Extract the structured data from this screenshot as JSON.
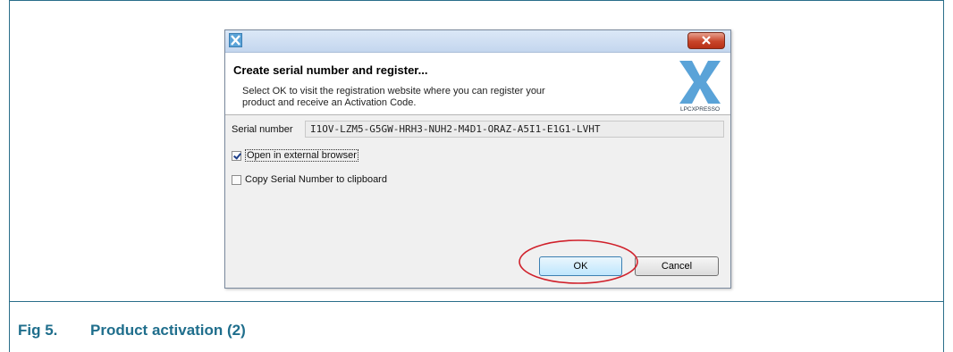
{
  "dialog": {
    "header_title": "Create serial number and register...",
    "header_description": "Select OK to visit the registration website where you can register your product and receive an Activation Code.",
    "logo_text": "LPCXPRESSO",
    "serial_label": "Serial number",
    "serial_value": "I1OV-LZM5-G5GW-HRH3-NUH2-M4D1-ORAZ-A5I1-E1G1-LVHT",
    "options": [
      {
        "label": "Open in external browser",
        "checked": true
      },
      {
        "label": "Copy Serial Number to clipboard",
        "checked": false
      }
    ],
    "ok_label": "OK",
    "cancel_label": "Cancel"
  },
  "caption": {
    "number": "Fig 5.",
    "title": "Product activation (2)"
  },
  "colors": {
    "caption": "#1f6e8c",
    "highlight": "#d0202a",
    "logo": "#5aa3d8"
  },
  "icons": [
    "app-icon",
    "close-icon",
    "lpcxpresso-logo",
    "checkbox-checked-icon",
    "checkbox-unchecked-icon"
  ]
}
